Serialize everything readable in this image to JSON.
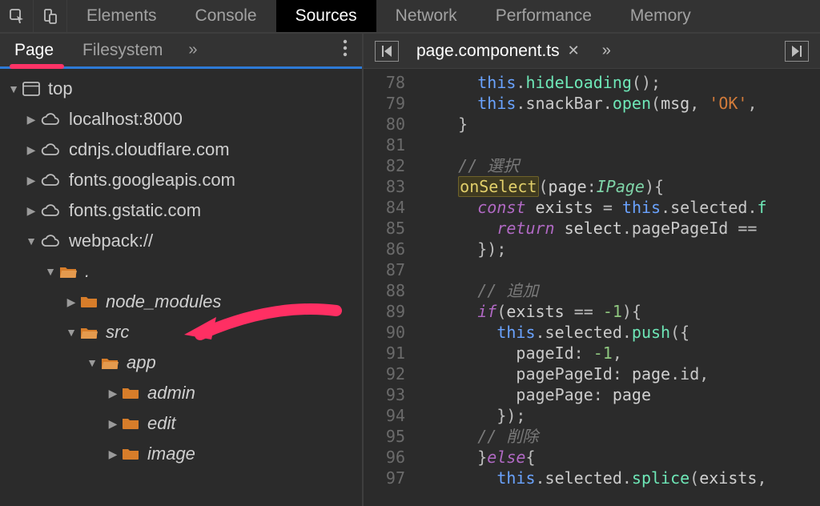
{
  "topTabs": {
    "elements": "Elements",
    "console": "Console",
    "sources": "Sources",
    "network": "Network",
    "performance": "Performance",
    "memory": "Memory"
  },
  "subTabs": {
    "page": "Page",
    "filesystem": "Filesystem",
    "more": "»"
  },
  "tree": {
    "top": "top",
    "localhost": "localhost:8000",
    "cdnjs": "cdnjs.cloudflare.com",
    "fontsGoogle": "fonts.googleapis.com",
    "fontsGstatic": "fonts.gstatic.com",
    "webpack": "webpack://",
    "dot": ".",
    "nodeModules": "node_modules",
    "src": "src",
    "app": "app",
    "admin": "admin",
    "edit": "edit",
    "image": "image"
  },
  "fileTab": {
    "name": "page.component.ts",
    "more": "»"
  },
  "code": {
    "firstLine": 78,
    "tokens": {
      "this": "this",
      "hideLoading": "hideLoading",
      "snackBar": "snackBar",
      "open": "open",
      "msg": "msg",
      "ok": "'OK'",
      "brace_close": "}",
      "comment_select": "// 選択",
      "onSelect": "onSelect",
      "page": "page",
      "IPage": "IPage",
      "brace_open": "{",
      "const": "const",
      "exists": "exists",
      "eq": "=",
      "selected": "selected",
      "f": "f",
      "return": "return",
      "select": "select",
      "pagePageId": "pagePageId",
      "eqeq": "==",
      "close_paren_brace": "});",
      "comment_add": "// 追加",
      "if": "if",
      "minus1": "-1",
      "push": "push",
      "pageIdKey": "pageId",
      "pagePageIdKey": "pagePageId",
      "idProp": "id",
      "pagePageKey": "pagePage",
      "comment_delete": "// 削除",
      "else": "else",
      "splice": "splice",
      "comma": ","
    }
  }
}
